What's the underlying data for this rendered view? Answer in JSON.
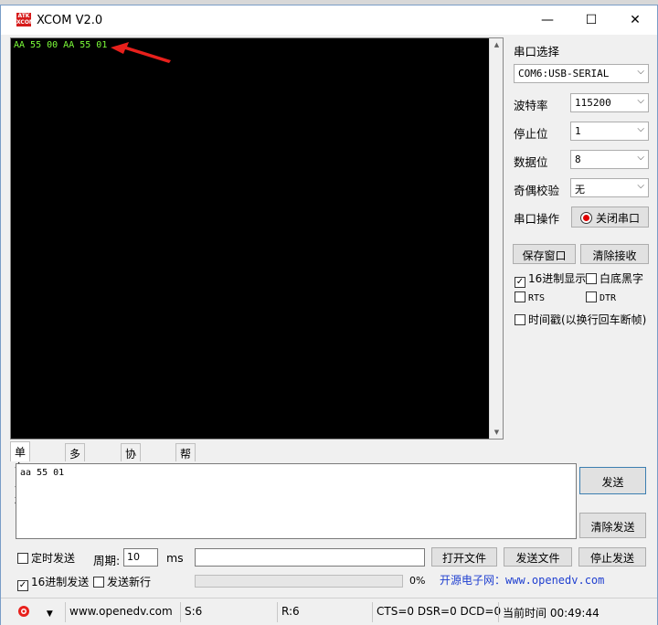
{
  "window": {
    "title": "XCOM V2.0",
    "logo_text": "ATK XCOM"
  },
  "controls": {
    "minimize": "—",
    "maximize": "☐",
    "close": "✕"
  },
  "receive": {
    "text": "AA 55 00 AA 55 01"
  },
  "settings": {
    "port_label": "串口选择",
    "port_value": "COM6:USB-SERIAL",
    "baud_label": "波特率",
    "baud_value": "115200",
    "stop_label": "停止位",
    "stop_value": "1",
    "data_label": "数据位",
    "data_value": "8",
    "parity_label": "奇偶校验",
    "parity_value": "无",
    "op_label": "串口操作",
    "op_button": "关闭串口"
  },
  "buttons": {
    "save_window": "保存窗口",
    "clear_receive": "清除接收",
    "send": "发送",
    "clear_send": "清除发送",
    "open_file": "打开文件",
    "send_file": "发送文件",
    "stop_send": "停止发送"
  },
  "options": {
    "hex_display": "16进制显示",
    "white_bg": "白底黑字",
    "rts": "RTS",
    "dtr": "DTR",
    "timestamp": "时间戳(以换行回车断帧)",
    "timed_send": "定时发送",
    "period_label": "周期:",
    "period_value": "10",
    "period_unit": "ms",
    "hex_send": "16进制发送",
    "send_newline": "发送新行"
  },
  "tabs": [
    "单条发送",
    "多条发送",
    "协议传输",
    "帮助"
  ],
  "send": {
    "text": "aa 55 01"
  },
  "progress": {
    "percent_text": "0%",
    "value": 0
  },
  "link": {
    "text": "开源电子网：www.openedv.com"
  },
  "status": {
    "url": "www.openedv.com",
    "sent": "S:6",
    "received": "R:6",
    "signals": "CTS=0 DSR=0 DCD=0",
    "time": "当前时间 00:49:44"
  },
  "colors": {
    "rx_text": "#7dff3a",
    "arrow": "#e8201c",
    "link": "#1f3fd0"
  }
}
